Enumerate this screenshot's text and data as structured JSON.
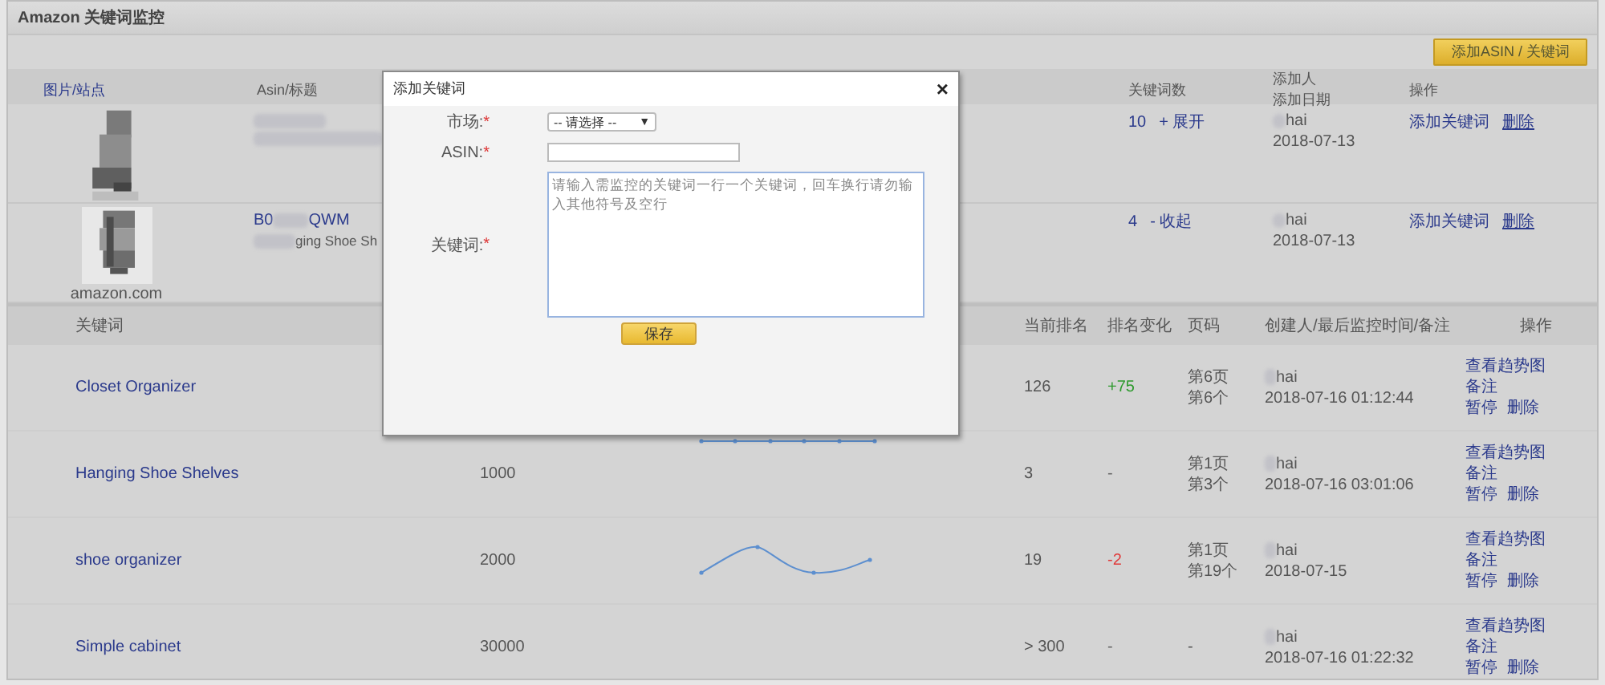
{
  "window": {
    "title": "Amazon 关键词监控"
  },
  "toolbar": {
    "add_button": "添加ASIN / 关键词"
  },
  "products": {
    "columns": {
      "image": "图片/站点",
      "asin": "Asin/标题",
      "count": "关键词数",
      "adder": [
        "添加人",
        "添加日期"
      ],
      "actions": "操作"
    },
    "rows": [
      {
        "count": "10",
        "toggle": "+ 展开",
        "user": "hai",
        "date": "2018-07-13",
        "actions": [
          "添加关键词",
          "删除"
        ]
      },
      {
        "site": "amazon.com",
        "asin_start": "B0",
        "asin_end": "QWM",
        "title_end": "ging Shoe Sh",
        "count": "4",
        "toggle": "- 收起",
        "user": "hai",
        "date": "2018-07-13",
        "actions": [
          "添加关键词",
          "删除"
        ]
      }
    ]
  },
  "keywords": {
    "columns": {
      "keyword": "关键词",
      "rank": "当前排名",
      "change": "排名变化",
      "page": "页码",
      "creator": "创建人/最后监控时间/备注",
      "actions": "操作"
    },
    "rows": [
      {
        "keyword": "Closet Organizer",
        "rank": "126",
        "change": {
          "text": "+75",
          "kind": "up"
        },
        "page": [
          "第6页",
          "第6个"
        ],
        "user": "hai",
        "time": "2018-07-16 01:12:44",
        "actions": [
          "查看趋势图",
          "备注",
          "暂停",
          "删除"
        ]
      },
      {
        "keyword": "Hanging Shoe Shelves",
        "volume": "1000",
        "sparkline": {
          "kind": "flat"
        },
        "rank": "3",
        "change": {
          "text": "-",
          "kind": "none"
        },
        "page": [
          "第1页",
          "第3个"
        ],
        "user": "hai",
        "time": "2018-07-16 03:01:06",
        "actions": [
          "查看趋势图",
          "备注",
          "暂停",
          "删除"
        ]
      },
      {
        "keyword": "shoe organizer",
        "volume": "2000",
        "sparkline": {
          "kind": "curve"
        },
        "rank": "19",
        "change": {
          "text": "-2",
          "kind": "down"
        },
        "page": [
          "第1页",
          "第19个"
        ],
        "user": "hai",
        "time": "2018-07-15",
        "actions": [
          "查看趋势图",
          "备注",
          "暂停",
          "删除"
        ]
      },
      {
        "keyword": "Simple cabinet",
        "volume": "30000",
        "rank": "> 300",
        "change": {
          "text": "-",
          "kind": "none"
        },
        "page": [
          "-"
        ],
        "user": "hai",
        "time": "2018-07-16 01:22:32",
        "actions": [
          "查看趋势图",
          "备注",
          "暂停",
          "删除"
        ]
      }
    ]
  },
  "dialog": {
    "title": "添加关键词",
    "close": "×",
    "fields": [
      {
        "kind": "select",
        "label": "市场:",
        "required_mark": "*",
        "value": "-- 请选择 --",
        "caret": "▼"
      },
      {
        "kind": "input",
        "label": "ASIN:",
        "required_mark": "*"
      },
      {
        "kind": "textarea",
        "label": "关键词:",
        "required_mark": "*",
        "placeholder": "请输入需监控的关键词一行一个关键词，回车换行请勿输入其他符号及空行"
      }
    ],
    "save_button": "保存"
  }
}
